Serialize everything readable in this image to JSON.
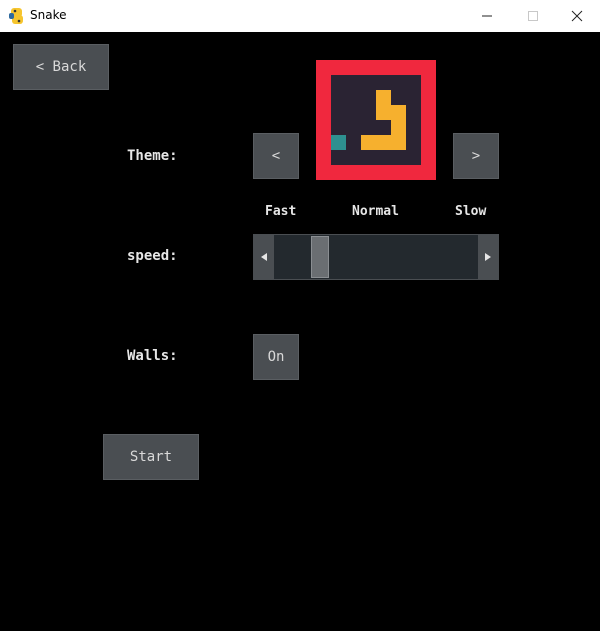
{
  "window": {
    "title": "Snake",
    "icon": "python-snake-icon",
    "controls": {
      "minimize": "—",
      "maximize": "☐",
      "close": "✕"
    }
  },
  "menu": {
    "back_label": "< Back",
    "theme_label": "Theme:",
    "theme_prev": "<",
    "theme_next": ">",
    "speed_label": "speed:",
    "speed_options": [
      "Fast",
      "Normal",
      "Slow"
    ],
    "speed_value": 0.2,
    "walls_label": "Walls:",
    "walls_value": "On",
    "start_label": "Start"
  },
  "theme_preview": {
    "border_color": "#f0283e",
    "background_color": "#2a2333",
    "snake_color": "#f6b02e",
    "food_color": "#2e9090"
  }
}
